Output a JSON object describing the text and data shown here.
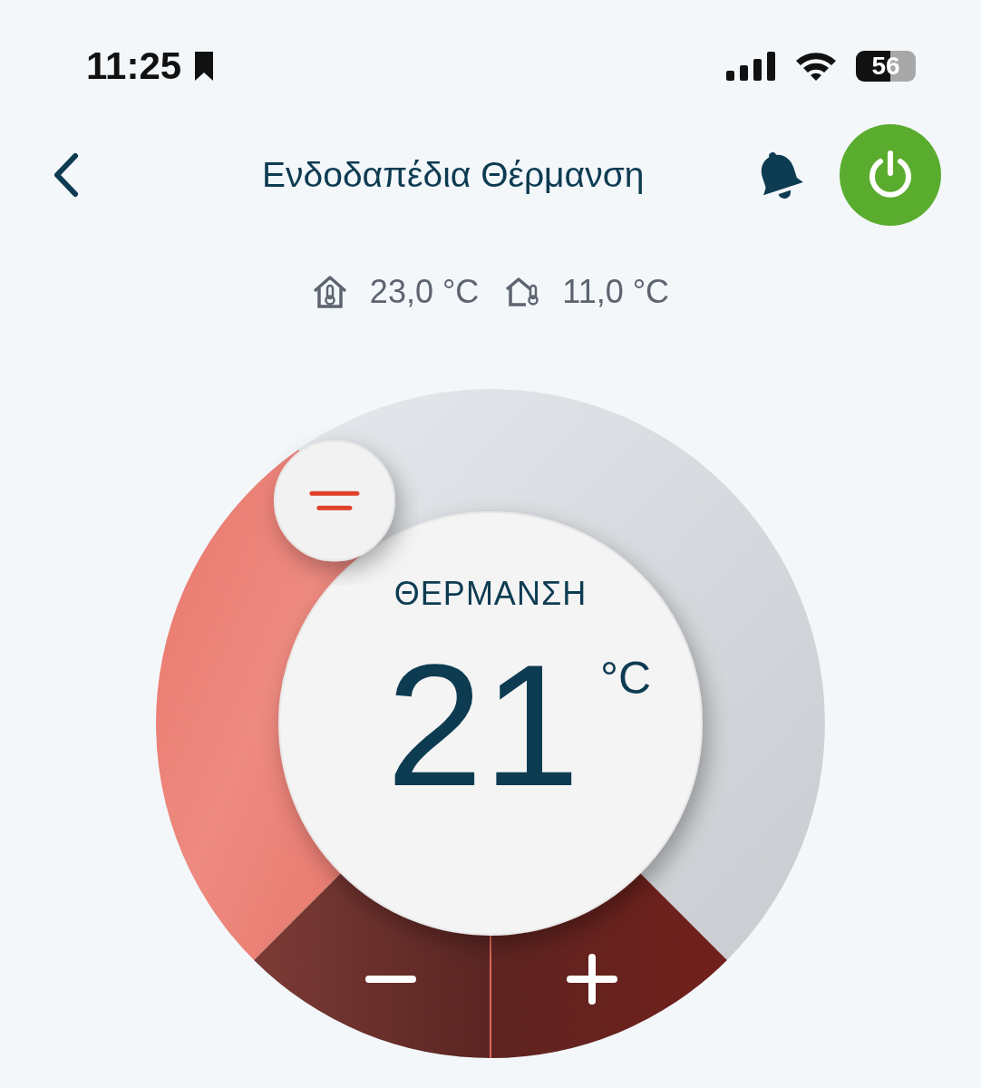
{
  "status_bar": {
    "time": "11:25",
    "battery": "56"
  },
  "header": {
    "title": "Ενδοδαπέδια Θέρμανση",
    "power": {
      "on": true
    }
  },
  "readings": [
    {
      "kind": "indoor",
      "value": "23,0 °C"
    },
    {
      "kind": "outdoor",
      "value": "11,0 °C"
    }
  ],
  "dial": {
    "mode": "ΘΕΡΜΑΝΣΗ",
    "setpoint": "21",
    "unit": "°C"
  }
}
